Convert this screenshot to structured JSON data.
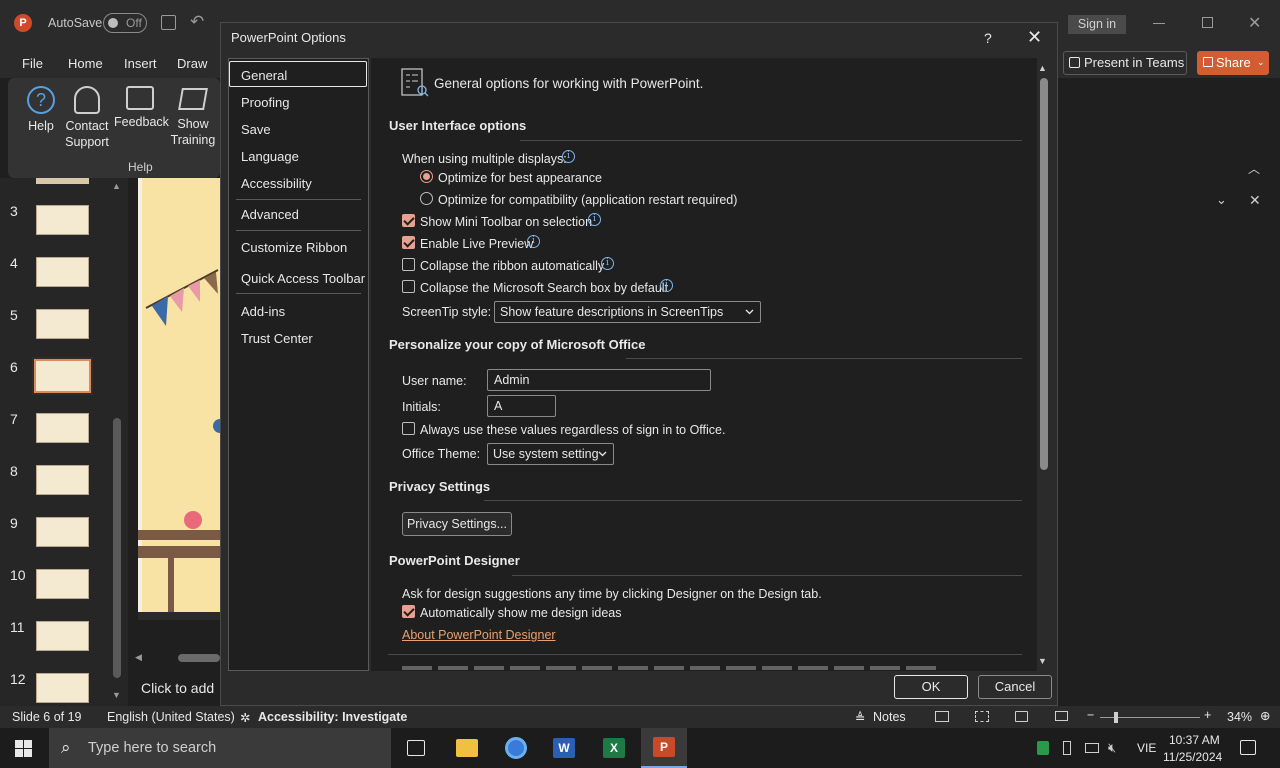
{
  "app": {
    "autosave_label": "AutoSave",
    "autosave_state": "Off",
    "signin_label": "Sign in",
    "menu_tabs": [
      "File",
      "Home",
      "Insert",
      "Draw"
    ],
    "present_teams_label": "Present in Teams",
    "share_label": "Share",
    "ribbon": {
      "help": "Help",
      "contact_support_1": "Contact",
      "contact_support_2": "Support",
      "feedback": "Feedback",
      "show_training_1": "Show",
      "show_training_2": "Training",
      "group_label": "Help"
    },
    "thumbnails": [
      "3",
      "4",
      "5",
      "6",
      "7",
      "8",
      "9",
      "10",
      "11",
      "12"
    ],
    "selected_slide": "6",
    "click_to_add": "Click to add",
    "status": {
      "slide": "Slide 6 of 19",
      "language": "English (United States)",
      "accessibility": "Accessibility: Investigate",
      "notes": "Notes",
      "zoom": "34%"
    },
    "taskbar": {
      "search_placeholder": "Type here to search",
      "lang": "VIE",
      "time": "10:37 AM",
      "date": "11/25/2024"
    }
  },
  "dialog": {
    "title": "PowerPoint Options",
    "help": "?",
    "nav": [
      "General",
      "Proofing",
      "Save",
      "Language",
      "Accessibility",
      "Advanced",
      "Customize Ribbon",
      "Quick Access Toolbar",
      "Add-ins",
      "Trust Center"
    ],
    "header": "General options for working with PowerPoint.",
    "ui_options": {
      "heading": "User Interface options",
      "multiple_displays": "When using multiple displays:",
      "opt_best": "Optimize for best appearance",
      "opt_compat": "Optimize for compatibility (application restart required)",
      "mini_toolbar": "Show Mini Toolbar on selection",
      "live_preview": "Enable Live Preview",
      "collapse_ribbon": "Collapse the ribbon automatically",
      "collapse_search": "Collapse the Microsoft Search box by default",
      "screentip_label": "ScreenTip style:",
      "screentip_value": "Show feature descriptions in ScreenTips"
    },
    "personalize": {
      "heading": "Personalize your copy of Microsoft Office",
      "username_label": "User name:",
      "username_value": "Admin",
      "initials_label": "Initials:",
      "initials_value": "A",
      "always_use": "Always use these values regardless of sign in to Office.",
      "theme_label": "Office Theme:",
      "theme_value": "Use system setting"
    },
    "privacy": {
      "heading": "Privacy Settings",
      "button": "Privacy Settings..."
    },
    "designer": {
      "heading": "PowerPoint Designer",
      "desc": "Ask for design suggestions any time by clicking Designer on the Design tab.",
      "auto_show": "Automatically show me design ideas",
      "about_link": "About PowerPoint Designer"
    },
    "ok": "OK",
    "cancel": "Cancel"
  },
  "colors": {
    "accent": "#e8a090",
    "share": "#d25d32",
    "info": "#7eb6f0",
    "link": "#e8a070"
  }
}
